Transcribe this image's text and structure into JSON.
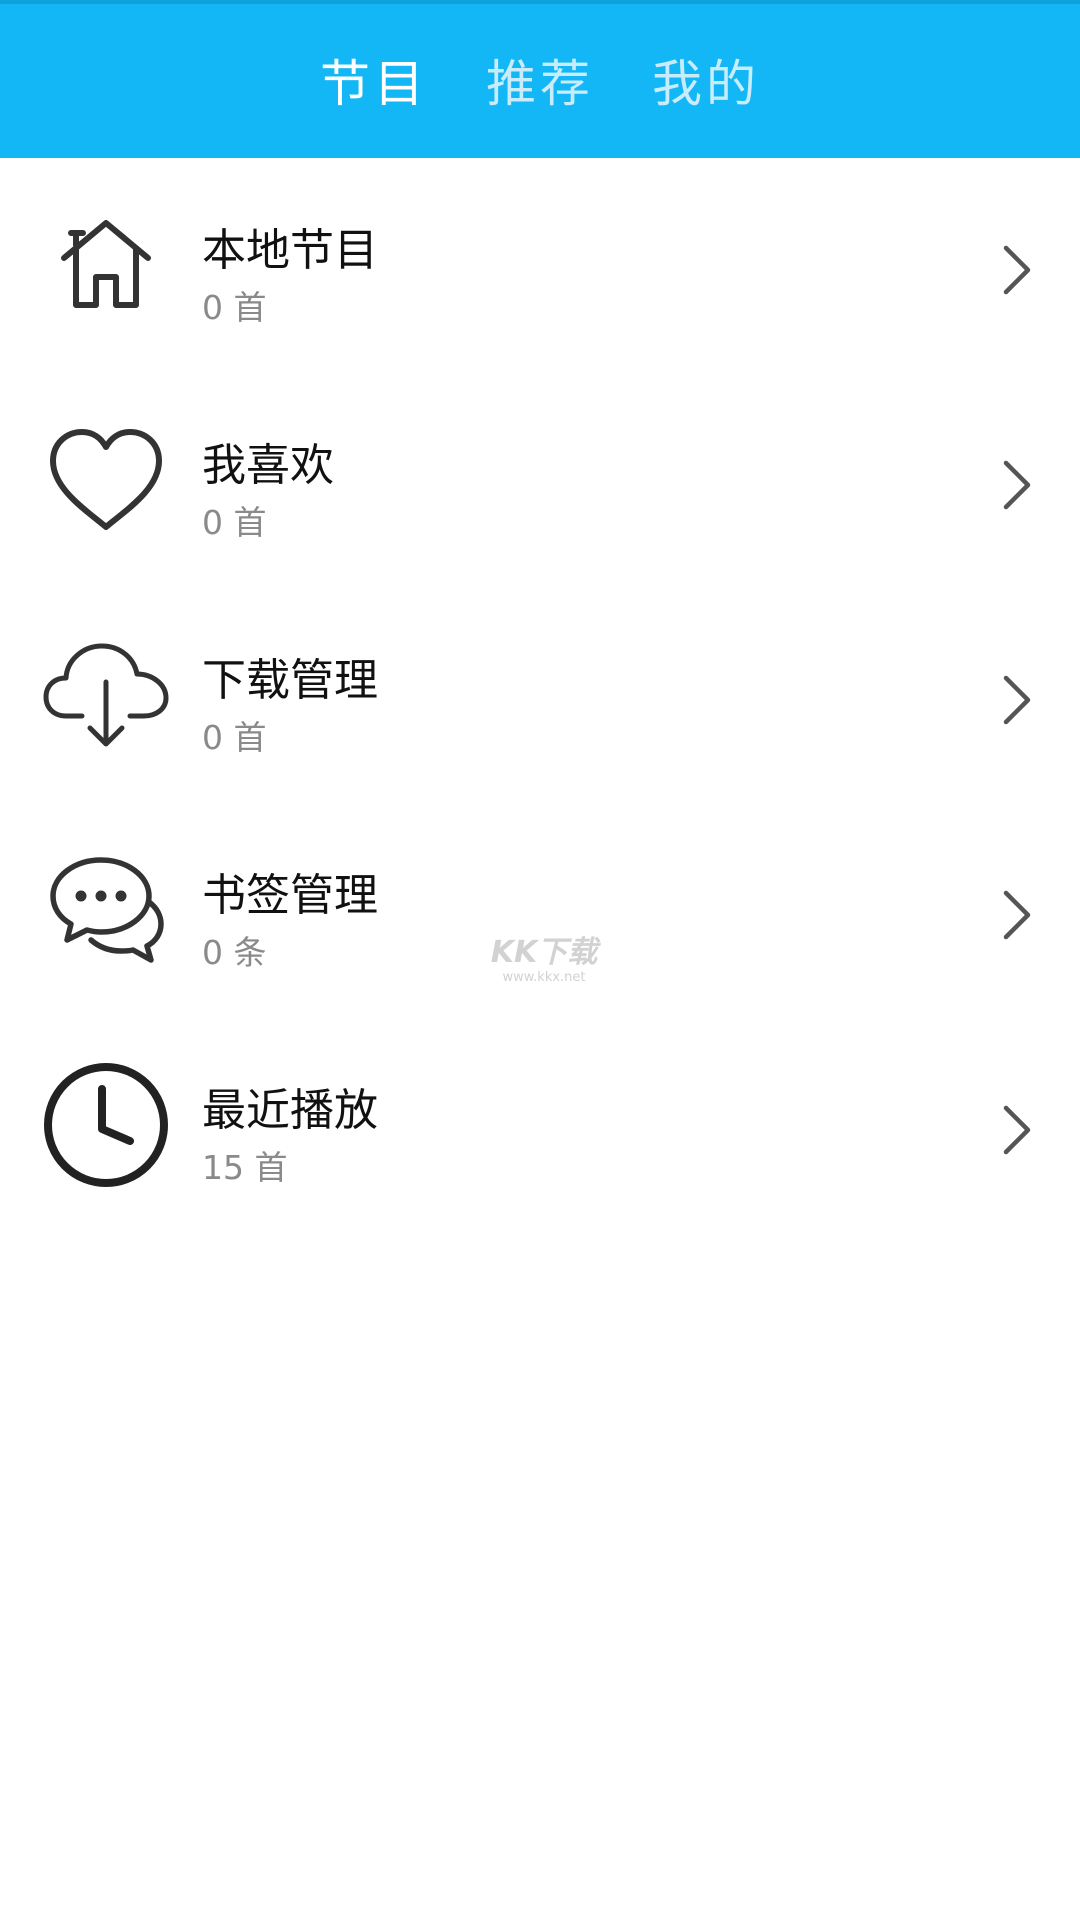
{
  "header": {
    "tabs": [
      {
        "label": "节目",
        "active": true
      },
      {
        "label": "推荐",
        "active": false
      },
      {
        "label": "我的",
        "active": false
      }
    ],
    "background_color": "#13b7f6"
  },
  "menu": {
    "items": [
      {
        "icon": "home-icon",
        "title": "本地节目",
        "count": "0 首"
      },
      {
        "icon": "heart-icon",
        "title": "我喜欢",
        "count": "0 首"
      },
      {
        "icon": "cloud-download-icon",
        "title": "下载管理",
        "count": "0 首"
      },
      {
        "icon": "chat-bubbles-icon",
        "title": "书签管理",
        "count": "0 条"
      },
      {
        "icon": "clock-icon",
        "title": "最近播放",
        "count": "15 首"
      }
    ]
  },
  "watermark": {
    "main": "KK下载",
    "sub": "www.kkx.net"
  }
}
